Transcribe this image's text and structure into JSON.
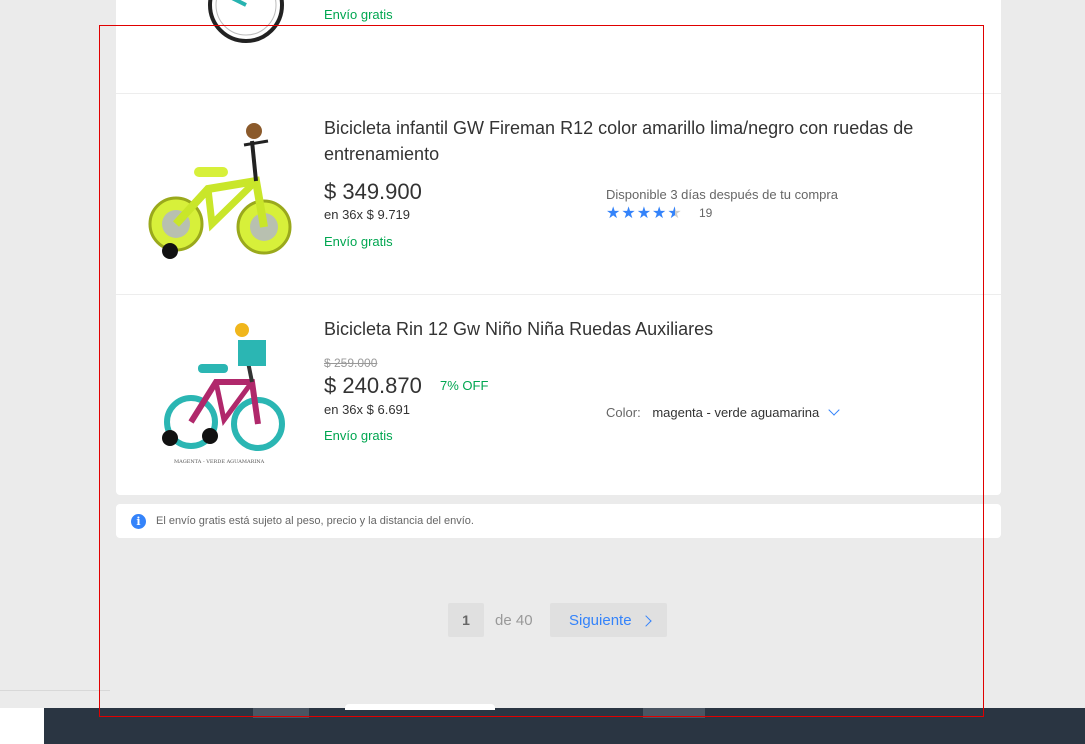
{
  "products": [
    {
      "title": "",
      "shipping": "Envío gratis"
    },
    {
      "title": "Bicicleta infantil GW Fireman R12 color amarillo lima/negro con ruedas de entrenamiento",
      "price": "$ 349.900",
      "installments": "en 36x $ 9.719",
      "shipping": "Envío gratis",
      "availability": "Disponible 3 días después de tu compra",
      "rating": 4.5,
      "stars": "★★★★★",
      "reviews": "19"
    },
    {
      "title": "Bicicleta Rin 12 Gw Niño Niña Ruedas Auxiliares",
      "original_price": "$ 259.000",
      "price": "$ 240.870",
      "discount": "7% OFF",
      "installments": "en 36x $ 6.691",
      "shipping": "Envío gratis",
      "color_label": "Color:",
      "color_value": "magenta - verde aguamarina",
      "image_caption": "MAGENTA - VERDE AGUAMARINA"
    }
  ],
  "notice": {
    "icon": "info-icon",
    "text": "El envío gratis está sujeto al peso, precio y la distancia del envío."
  },
  "pagination": {
    "current": "1",
    "total": "de 40",
    "next": "Siguiente"
  },
  "colors": {
    "accent": "#3483fa",
    "green": "#00a650",
    "highlight_box": "#e00000"
  }
}
